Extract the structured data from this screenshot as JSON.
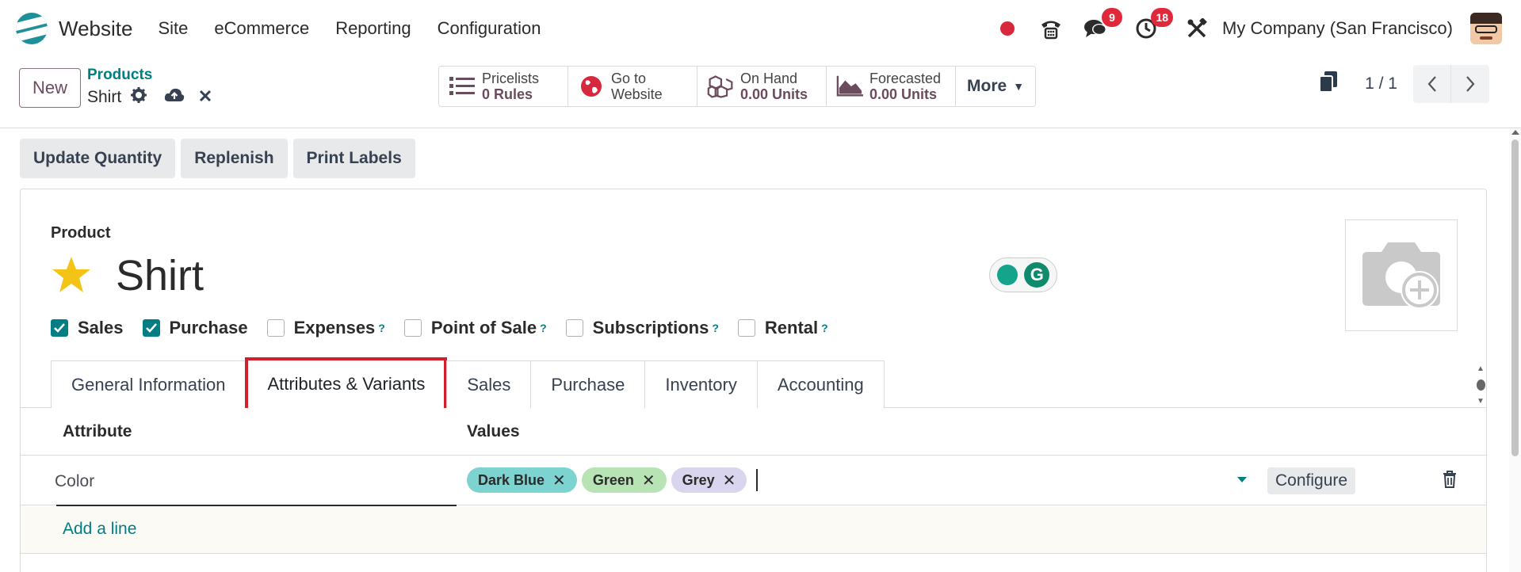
{
  "app": {
    "brand": "Website",
    "menu": [
      "Site",
      "eCommerce",
      "Reporting",
      "Configuration"
    ],
    "messages_badge": "9",
    "activities_badge": "18",
    "company": "My Company (San Francisco)"
  },
  "control_panel": {
    "new_label": "New",
    "breadcrumb_parent": "Products",
    "breadcrumb_current": "Shirt",
    "stats": {
      "pricelists": {
        "line1": "Pricelists",
        "line2": "0  Rules"
      },
      "website": {
        "line1": "Go to",
        "line2": "Website"
      },
      "on_hand": {
        "line1": "On Hand",
        "line2": "0.00 Units"
      },
      "forecasted": {
        "line1": "Forecasted",
        "line2": "0.00  Units"
      },
      "more": "More"
    },
    "pager": "1 / 1"
  },
  "actions": [
    "Update Quantity",
    "Replenish",
    "Print Labels"
  ],
  "form": {
    "product_label": "Product",
    "product_name": "Shirt",
    "starred": true,
    "checkboxes": [
      {
        "label": "Sales",
        "checked": true,
        "help": ""
      },
      {
        "label": "Purchase",
        "checked": true,
        "help": ""
      },
      {
        "label": "Expenses",
        "checked": false,
        "help": "?"
      },
      {
        "label": "Point of Sale",
        "checked": false,
        "help": "?"
      },
      {
        "label": "Subscriptions",
        "checked": false,
        "help": "?"
      },
      {
        "label": "Rental",
        "checked": false,
        "help": "?"
      }
    ],
    "tabs": [
      "General Information",
      "Attributes & Variants",
      "Sales",
      "Purchase",
      "Inventory",
      "Accounting"
    ],
    "active_tab": "Attributes & Variants"
  },
  "attributes_table": {
    "headers": {
      "attribute": "Attribute",
      "values": "Values"
    },
    "rows": [
      {
        "attribute": "Color",
        "values": [
          {
            "label": "Dark Blue",
            "color": "#7dd3d0"
          },
          {
            "label": "Green",
            "color": "#b8e3b4"
          },
          {
            "label": "Grey",
            "color": "#d9d5ee"
          }
        ],
        "configure_label": "Configure"
      }
    ],
    "add_line": "Add a line"
  },
  "colors": {
    "accent": "#017e84",
    "brand_purple": "#6b4b5e",
    "highlight": "#d21f2c",
    "star": "#f3c316"
  }
}
